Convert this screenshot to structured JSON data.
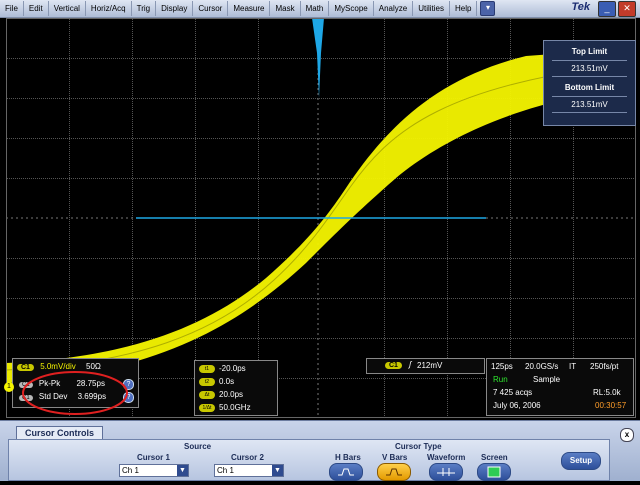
{
  "menu": [
    "File",
    "Edit",
    "Vertical",
    "Horiz/Acq",
    "Trig",
    "Display",
    "Cursor",
    "Measure",
    "Mask",
    "Math",
    "MyScope",
    "Analyze",
    "Utilities",
    "Help"
  ],
  "brand": "Tek",
  "limits": {
    "top_label": "Top Limit",
    "top_value": "213.51mV",
    "bottom_label": "Bottom Limit",
    "bottom_value": "213.51mV"
  },
  "channel": {
    "tag": "C1",
    "scale": "5.0mV/div",
    "impedance": "50Ω"
  },
  "measurements": [
    {
      "icon": "C1",
      "name": "Pk-Pk",
      "value": "28.75ps"
    },
    {
      "icon": "C1",
      "name": "Std Dev",
      "value": "3.699ps"
    }
  ],
  "marker_number": "1",
  "cursors": [
    {
      "tag": "t1",
      "value": "-20.0ps"
    },
    {
      "tag": "t2",
      "value": "0.0s"
    },
    {
      "tag": "Δt",
      "value": "20.0ps"
    },
    {
      "tag": "1/Δt",
      "value": "50.0GHz"
    }
  ],
  "trigger": {
    "tag": "C1",
    "value": "212mV"
  },
  "acq": {
    "timebase": "125ps",
    "sample_rate": "20.0GS/s",
    "mode": "IT",
    "resolution": "250fs/pt",
    "state": "Run",
    "sample_mode": "Sample",
    "acqs": "7 425 acqs",
    "record_length": "RL:5.0k",
    "date": "July 06, 2006",
    "time": "00:30:57"
  },
  "panel": {
    "title": "Cursor Controls",
    "source_label": "Source",
    "cursor1_label": "Cursor 1",
    "cursor1_value": "Ch 1",
    "cursor2_label": "Cursor 2",
    "cursor2_value": "Ch 1",
    "type_label": "Cursor Type",
    "types": [
      "H Bars",
      "V Bars",
      "Waveform",
      "Screen"
    ],
    "active_type": "V Bars",
    "setup_label": "Setup"
  },
  "colors": {
    "ch1": "#f5f500",
    "histogram": "#1ea7e6",
    "accent": "#e39a00"
  }
}
